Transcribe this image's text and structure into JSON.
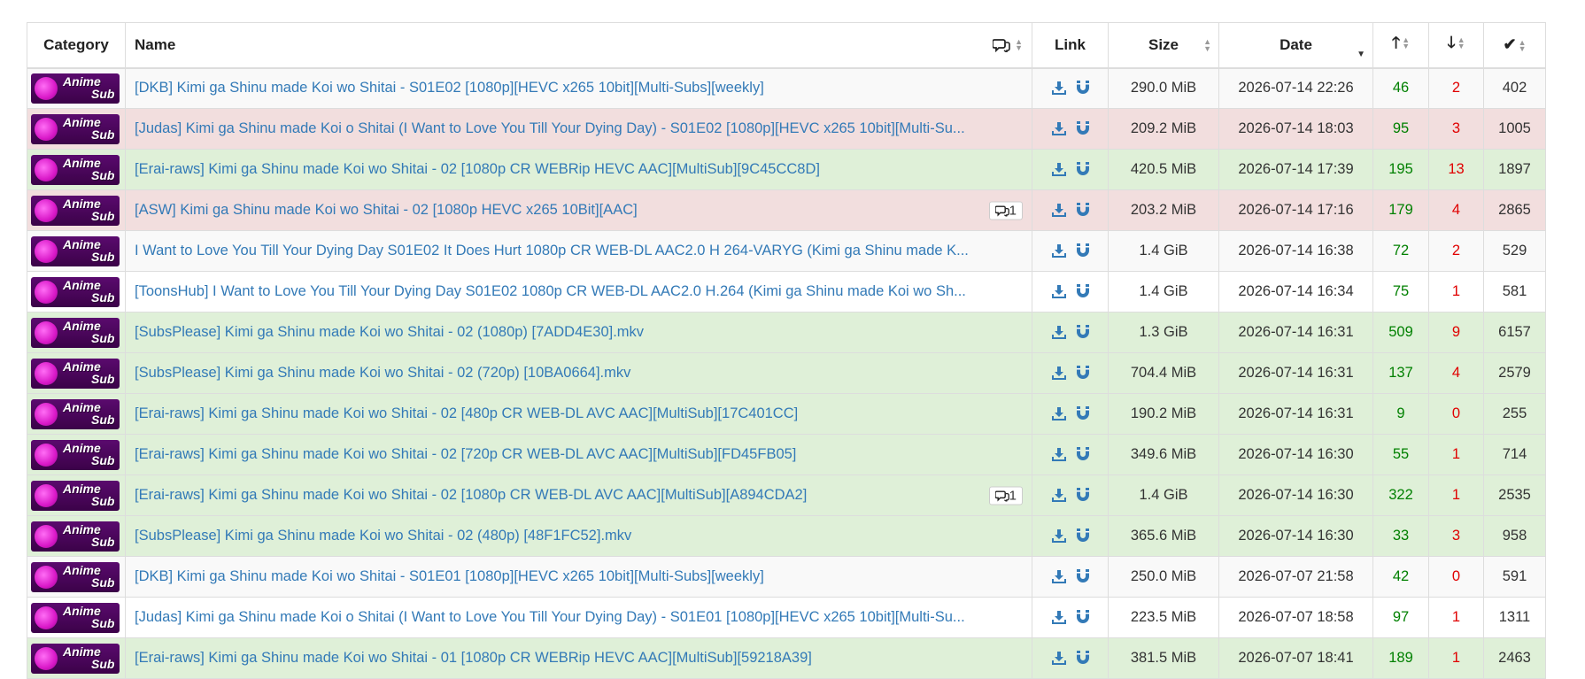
{
  "header": {
    "category": "Category",
    "name": "Name",
    "link": "Link",
    "size": "Size",
    "date": "Date"
  },
  "badge": {
    "line1": "Anime",
    "line2": "Sub"
  },
  "colors": {
    "link": "#337ab7",
    "seeders": "#008000",
    "leechers": "#e00000",
    "danger": "#f2dede",
    "success": "#dff0d8",
    "default": "#f9f9f9"
  },
  "rows": [
    {
      "type": "default",
      "name": "[DKB] Kimi ga Shinu made Koi wo Shitai - S01E02 [1080p][HEVC x265 10bit][Multi-Subs][weekly]",
      "comments": "",
      "size": "290.0 MiB",
      "date": "2026-07-14 22:26",
      "seeders": "46",
      "leechers": "2",
      "completed": "402"
    },
    {
      "type": "danger",
      "name": "[Judas] Kimi ga Shinu made Koi o Shitai (I Want to Love You Till Your Dying Day) - S01E02 [1080p][HEVC x265 10bit][Multi-Su...",
      "comments": "",
      "size": "209.2 MiB",
      "date": "2026-07-14 18:03",
      "seeders": "95",
      "leechers": "3",
      "completed": "1005"
    },
    {
      "type": "success",
      "name": "[Erai-raws] Kimi ga Shinu made Koi wo Shitai - 02 [1080p CR WEBRip HEVC AAC][MultiSub][9C45CC8D]",
      "comments": "",
      "size": "420.5 MiB",
      "date": "2026-07-14 17:39",
      "seeders": "195",
      "leechers": "13",
      "completed": "1897"
    },
    {
      "type": "danger",
      "name": "[ASW] Kimi ga Shinu made Koi wo Shitai - 02 [1080p HEVC x265 10Bit][AAC]",
      "comments": "1",
      "size": "203.2 MiB",
      "date": "2026-07-14 17:16",
      "seeders": "179",
      "leechers": "4",
      "completed": "2865"
    },
    {
      "type": "default",
      "name": "I Want to Love You Till Your Dying Day S01E02 It Does Hurt 1080p CR WEB-DL AAC2.0 H 264-VARYG (Kimi ga Shinu made K...",
      "comments": "",
      "size": "1.4 GiB",
      "date": "2026-07-14 16:38",
      "seeders": "72",
      "leechers": "2",
      "completed": "529"
    },
    {
      "type": "default alt",
      "name": "[ToonsHub] I Want to Love You Till Your Dying Day S01E02 1080p CR WEB-DL AAC2.0 H.264 (Kimi ga Shinu made Koi wo Sh...",
      "comments": "",
      "size": "1.4 GiB",
      "date": "2026-07-14 16:34",
      "seeders": "75",
      "leechers": "1",
      "completed": "581"
    },
    {
      "type": "success",
      "name": "[SubsPlease] Kimi ga Shinu made Koi wo Shitai - 02 (1080p) [7ADD4E30].mkv",
      "comments": "",
      "size": "1.3 GiB",
      "date": "2026-07-14 16:31",
      "seeders": "509",
      "leechers": "9",
      "completed": "6157"
    },
    {
      "type": "success",
      "name": "[SubsPlease] Kimi ga Shinu made Koi wo Shitai - 02 (720p) [10BA0664].mkv",
      "comments": "",
      "size": "704.4 MiB",
      "date": "2026-07-14 16:31",
      "seeders": "137",
      "leechers": "4",
      "completed": "2579"
    },
    {
      "type": "success",
      "name": "[Erai-raws] Kimi ga Shinu made Koi wo Shitai - 02 [480p CR WEB-DL AVC AAC][MultiSub][17C401CC]",
      "comments": "",
      "size": "190.2 MiB",
      "date": "2026-07-14 16:31",
      "seeders": "9",
      "leechers": "0",
      "completed": "255"
    },
    {
      "type": "success",
      "name": "[Erai-raws] Kimi ga Shinu made Koi wo Shitai - 02 [720p CR WEB-DL AVC AAC][MultiSub][FD45FB05]",
      "comments": "",
      "size": "349.6 MiB",
      "date": "2026-07-14 16:30",
      "seeders": "55",
      "leechers": "1",
      "completed": "714"
    },
    {
      "type": "success",
      "name": "[Erai-raws] Kimi ga Shinu made Koi wo Shitai - 02 [1080p CR WEB-DL AVC AAC][MultiSub][A894CDA2]",
      "comments": "1",
      "size": "1.4 GiB",
      "date": "2026-07-14 16:30",
      "seeders": "322",
      "leechers": "1",
      "completed": "2535"
    },
    {
      "type": "success",
      "name": "[SubsPlease] Kimi ga Shinu made Koi wo Shitai - 02 (480p) [48F1FC52].mkv",
      "comments": "",
      "size": "365.6 MiB",
      "date": "2026-07-14 16:30",
      "seeders": "33",
      "leechers": "3",
      "completed": "958"
    },
    {
      "type": "default",
      "name": "[DKB] Kimi ga Shinu made Koi wo Shitai - S01E01 [1080p][HEVC x265 10bit][Multi-Subs][weekly]",
      "comments": "",
      "size": "250.0 MiB",
      "date": "2026-07-07 21:58",
      "seeders": "42",
      "leechers": "0",
      "completed": "591"
    },
    {
      "type": "default alt",
      "name": "[Judas] Kimi ga Shinu made Koi o Shitai (I Want to Love You Till Your Dying Day) - S01E01 [1080p][HEVC x265 10bit][Multi-Su...",
      "comments": "",
      "size": "223.5 MiB",
      "date": "2026-07-07 18:58",
      "seeders": "97",
      "leechers": "1",
      "completed": "1311"
    },
    {
      "type": "success",
      "name": "[Erai-raws] Kimi ga Shinu made Koi wo Shitai - 01 [1080p CR WEBRip HEVC AAC][MultiSub][59218A39]",
      "comments": "",
      "size": "381.5 MiB",
      "date": "2026-07-07 18:41",
      "seeders": "189",
      "leechers": "1",
      "completed": "2463"
    }
  ]
}
